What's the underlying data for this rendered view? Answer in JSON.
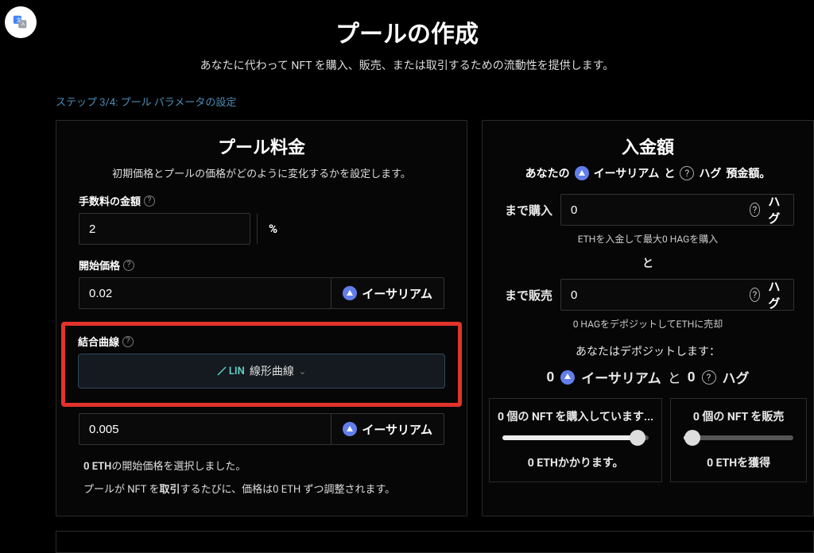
{
  "header": {
    "title": "プールの作成",
    "subtitle": "あなたに代わって NFT を購入、販売、または取引するための流動性を提供します。"
  },
  "step": "ステップ 3/4: プール パラメータの設定",
  "left": {
    "title": "プール料金",
    "subtitle": "初期価格とプールの価格がどのように変化するかを設定します。",
    "fee_label": "手数料の金額",
    "fee_value": "2",
    "fee_unit": "%",
    "start_label": "開始価格",
    "start_value": "0.02",
    "eth_label": "イーサリアム",
    "curve_label": "結合曲線",
    "curve_lin": "LIN",
    "curve_text": "線形曲線",
    "delta_value": "0.005",
    "note1_pre": "0 ETH",
    "note1_post": "の開始価格を選択しました。",
    "note2_pre": "プールが NFT を",
    "note2_mid": "取引",
    "note2_post": "するたびに、価格は0 ETH ずつ調整されます。"
  },
  "right": {
    "title": "入金額",
    "deposit_pre": "あなたの",
    "eth_label": "イーサリアム",
    "and": "と",
    "hag_label": "ハグ",
    "deposit_post": "預金額。",
    "buy_label": "まで購入",
    "buy_value": "0",
    "buy_unit": "ハグ",
    "buy_hint": "ETHを入金して最大0 HAGを購入",
    "sep": "と",
    "sell_label": "まで販売",
    "sell_value": "0",
    "sell_unit": "ハグ",
    "sell_hint": "0 HAGをデポジットしてETHに売却",
    "will_deposit": "あなたはデポジットします：",
    "d_eth_amount": "0",
    "d_eth_label": "イーサリアム",
    "d_and": "と",
    "d_hag_amount": "0",
    "d_hag_label": "ハグ",
    "mini_buy_title": "0 個の NFT を購入しています...",
    "mini_buy_result": "0 ETHかかります。",
    "mini_sell_title": "0 個の NFT を販売",
    "mini_sell_result": "0 ETHを獲得"
  }
}
